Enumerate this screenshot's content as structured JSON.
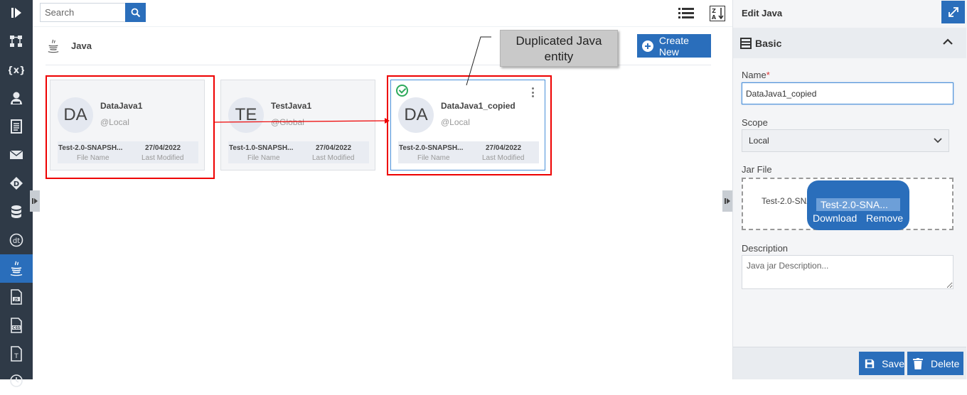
{
  "nav": {
    "items": [
      {
        "icon": "flow-icon"
      },
      {
        "icon": "variables-icon"
      },
      {
        "icon": "user-icon"
      },
      {
        "icon": "document-icon"
      },
      {
        "icon": "mail-icon"
      },
      {
        "icon": "d-icon"
      },
      {
        "icon": "database-icon"
      },
      {
        "icon": "dt-icon"
      },
      {
        "icon": "java-icon",
        "active": true
      },
      {
        "icon": "js-file-icon"
      },
      {
        "icon": "css-file-icon"
      },
      {
        "icon": "text-file-icon"
      },
      {
        "icon": "clock-icon"
      }
    ]
  },
  "search": {
    "placeholder": "Search"
  },
  "list_header": {
    "title": "Java",
    "create_label": "Create New"
  },
  "callout": {
    "line1": "Duplicated Java",
    "line2": "entity"
  },
  "cards": [
    {
      "initials": "DA",
      "name": "DataJava1",
      "scope": "@Local",
      "file": "Test-2.0-SNAPSH...",
      "date": "27/04/2022",
      "file_label": "File Name",
      "date_label": "Last Modified",
      "highlighted": true
    },
    {
      "initials": "TE",
      "name": "TestJava1",
      "scope": "@Global",
      "file": "Test-1.0-SNAPSH...",
      "date": "27/04/2022",
      "file_label": "File Name",
      "date_label": "Last Modified",
      "highlighted": false
    },
    {
      "initials": "DA",
      "name": "DataJava1_copied",
      "scope": "@Local",
      "file": "Test-2.0-SNAPSH...",
      "date": "27/04/2022",
      "file_label": "File Name",
      "date_label": "Last Modified",
      "highlighted": true,
      "selected": true
    }
  ],
  "panel": {
    "title": "Edit Java",
    "section": "Basic",
    "name_label": "Name",
    "required_mark": "*",
    "name_value": "DataJava1_copied",
    "scope_label": "Scope",
    "scope_value": "Local",
    "jar_label": "Jar File",
    "jar_file_text": "Test-2.0-SNAPSHOT.jar",
    "jar_popup_name": "Test-2.0-SNA...",
    "jar_download": "Download",
    "jar_remove": "Remove",
    "desc_label": "Description",
    "desc_placeholder": "Java jar Description...",
    "save_label": "Save",
    "delete_label": "Delete"
  },
  "colors": {
    "accent": "#2a6ebb",
    "nav_bg": "#2f3a47",
    "highlight": "#e00000",
    "success": "#2eaa5c"
  }
}
